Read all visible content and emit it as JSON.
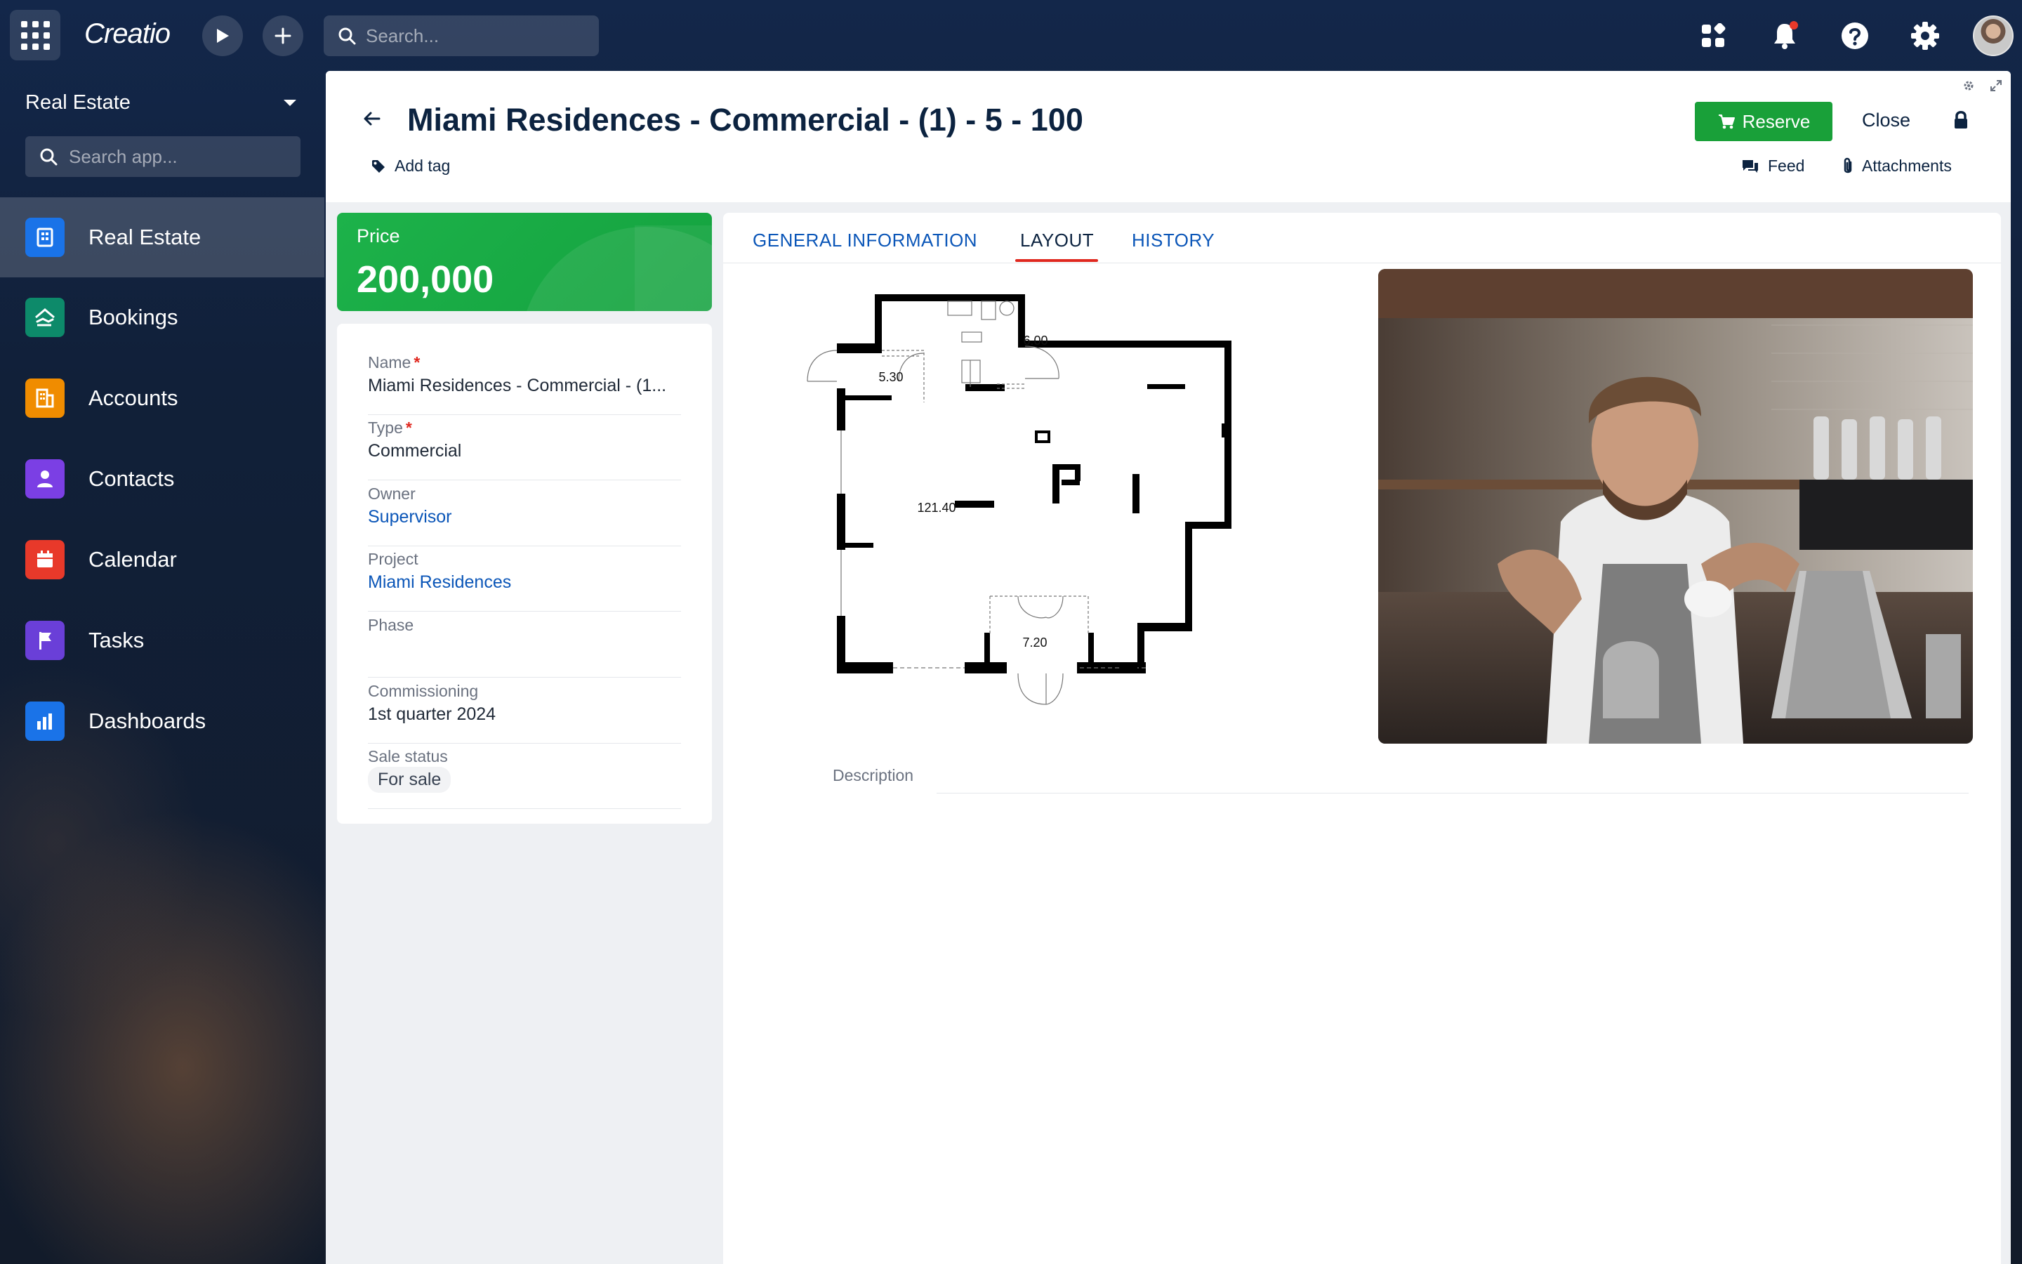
{
  "app": {
    "logo": "Creatio",
    "search_placeholder": "Search..."
  },
  "sidebar": {
    "workspace": "Real Estate",
    "search_placeholder": "Search app...",
    "items": [
      {
        "label": "Real Estate",
        "color": "#1a73e8",
        "icon": "building-icon",
        "active": true
      },
      {
        "label": "Bookings",
        "color": "#0d8a6a",
        "icon": "handshake-icon"
      },
      {
        "label": "Accounts",
        "color": "#f08c00",
        "icon": "office-icon"
      },
      {
        "label": "Contacts",
        "color": "#7b3fe4",
        "icon": "person-icon"
      },
      {
        "label": "Calendar",
        "color": "#e8392a",
        "icon": "calendar-icon"
      },
      {
        "label": "Tasks",
        "color": "#6a3fd8",
        "icon": "flag-icon"
      },
      {
        "label": "Dashboards",
        "color": "#1a73e8",
        "icon": "bar-chart-icon"
      }
    ]
  },
  "record": {
    "title": "Miami Residences - Commercial - (1) - 5 - 100",
    "add_tag": "Add tag",
    "reserve_label": "Reserve",
    "close_label": "Close",
    "feed_label": "Feed",
    "attachments_label": "Attachments"
  },
  "price": {
    "label": "Price",
    "value": "200,000"
  },
  "fields": {
    "name": {
      "label": "Name",
      "value": "Miami Residences - Commercial - (1..."
    },
    "type": {
      "label": "Type",
      "value": "Commercial"
    },
    "owner": {
      "label": "Owner",
      "value": "Supervisor"
    },
    "project": {
      "label": "Project",
      "value": "Miami Residences"
    },
    "phase": {
      "label": "Phase",
      "value": ""
    },
    "commissioning": {
      "label": "Commissioning",
      "value": "1st quarter 2024"
    },
    "sale_status": {
      "label": "Sale status",
      "value": "For sale"
    }
  },
  "tabs": [
    {
      "label": "GENERAL INFORMATION"
    },
    {
      "label": "LAYOUT",
      "active": true
    },
    {
      "label": "HISTORY"
    }
  ],
  "layout": {
    "room_areas": [
      "5.30",
      "6.00",
      "121.40",
      "7.20"
    ],
    "description_label": "Description"
  },
  "colors": {
    "accent_green": "#19a039",
    "link_blue": "#0b56b8",
    "tab_active_underline": "#e0281f",
    "title_navy": "#0c2340"
  }
}
